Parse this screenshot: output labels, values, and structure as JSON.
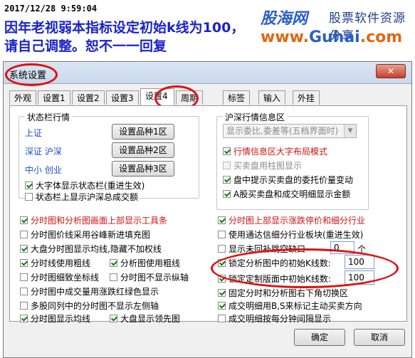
{
  "note": {
    "timestamp": "2017/12/28 9:59:04",
    "text": "因年老视弱本指标设定初始k线为100，请自己调整。恕不一一回复"
  },
  "watermark": {
    "brand_cn": "股海网",
    "slogan": "股票软件资源分享",
    "url_prefix": "www.",
    "url_name": "Guhai",
    "url_suffix": ".com"
  },
  "dialog": {
    "title": "系统设置",
    "close_label": "✕",
    "tabs": [
      {
        "label": "外观"
      },
      {
        "label": "设置1"
      },
      {
        "label": "设置2"
      },
      {
        "label": "设置3"
      },
      {
        "label": "设置4",
        "active": true
      },
      {
        "label": "周期"
      },
      {
        "label": "标签"
      },
      {
        "label": "输入"
      },
      {
        "label": "外挂"
      }
    ],
    "status_group": {
      "title": "状态栏行情",
      "rows": [
        {
          "label": "上证",
          "button": "设置品种1区"
        },
        {
          "label": "深证 沪深",
          "button": "设置品种2区"
        },
        {
          "label": "中小 创业",
          "button": "设置品种3区"
        }
      ],
      "checks": [
        {
          "label": "大字体显示状态栏(重进生效)",
          "checked": true
        },
        {
          "label": "状态栏上显示沪深总成交额",
          "checked": false
        }
      ]
    },
    "hs_group": {
      "title": "沪深行情信息区",
      "select_value": "显示委比,委差等(五档界面时)",
      "checks": [
        {
          "label": "行情信息区大字布局模式",
          "checked": true,
          "red": true,
          "disabled": false
        },
        {
          "label": "买卖盘用柱图显示",
          "checked": false,
          "red": false,
          "disabled": true
        },
        {
          "label": "盘中提示买卖盘的委托价量变动",
          "checked": true,
          "red": false,
          "disabled": false
        },
        {
          "label": "A股买卖盘和成交明细显示金额",
          "checked": true,
          "red": false,
          "disabled": false
        }
      ]
    },
    "left_options": [
      {
        "label": "分时图和分析图画面上部显示工具条",
        "checked": true,
        "red": true
      },
      {
        "label": "分时图价线采用谷峰新进填充图",
        "checked": false,
        "red": false
      },
      {
        "label": "大盘分时图显示均线,隐藏不加权线",
        "checked": true,
        "red": false
      },
      {
        "label": "分时线使用粗线",
        "checked": true,
        "red": false
      },
      {
        "label": "分析图使用粗线",
        "checked": true,
        "red": false
      },
      {
        "label": "分时图细致坐标线",
        "checked": false,
        "red": false
      },
      {
        "label": "分时图不显示纵轴",
        "checked": false,
        "red": false
      },
      {
        "label": "分时图中成交量用涨跌红绿色显示",
        "checked": false,
        "red": false
      },
      {
        "label": "多股同列中的分时图不显示左侧轴",
        "checked": false,
        "red": false
      },
      {
        "label": "分时图显示均线",
        "checked": true,
        "red": false
      },
      {
        "label": "大盘显示领先图",
        "checked": true,
        "red": false
      }
    ],
    "right_options": [
      {
        "label": "分时图上部显示涨跌停价和细分行业",
        "checked": true,
        "red": true
      },
      {
        "label": "使用通达信细分行业板块(重进生效)",
        "checked": false,
        "red": false
      },
      {
        "label": "显示未回补跳空缺口",
        "checked": false,
        "red": false,
        "input": "0",
        "suffix": "个"
      },
      {
        "label": "锁定分析图中的初始K线数:",
        "checked": true,
        "red": false,
        "input": "100"
      },
      {
        "label": "锁定定制版面中初始K线数:",
        "checked": true,
        "red": false,
        "input": "100"
      },
      {
        "label": "固定分时和分析图右下角切换区",
        "checked": true,
        "red": false
      },
      {
        "label": "成交明细用B,S来标记主动买卖方向",
        "checked": true,
        "red": false
      },
      {
        "label": "成交明细按每分钟间隔显示",
        "checked": false,
        "red": false
      }
    ],
    "ok_label": "确定",
    "cancel_label": "取消"
  }
}
